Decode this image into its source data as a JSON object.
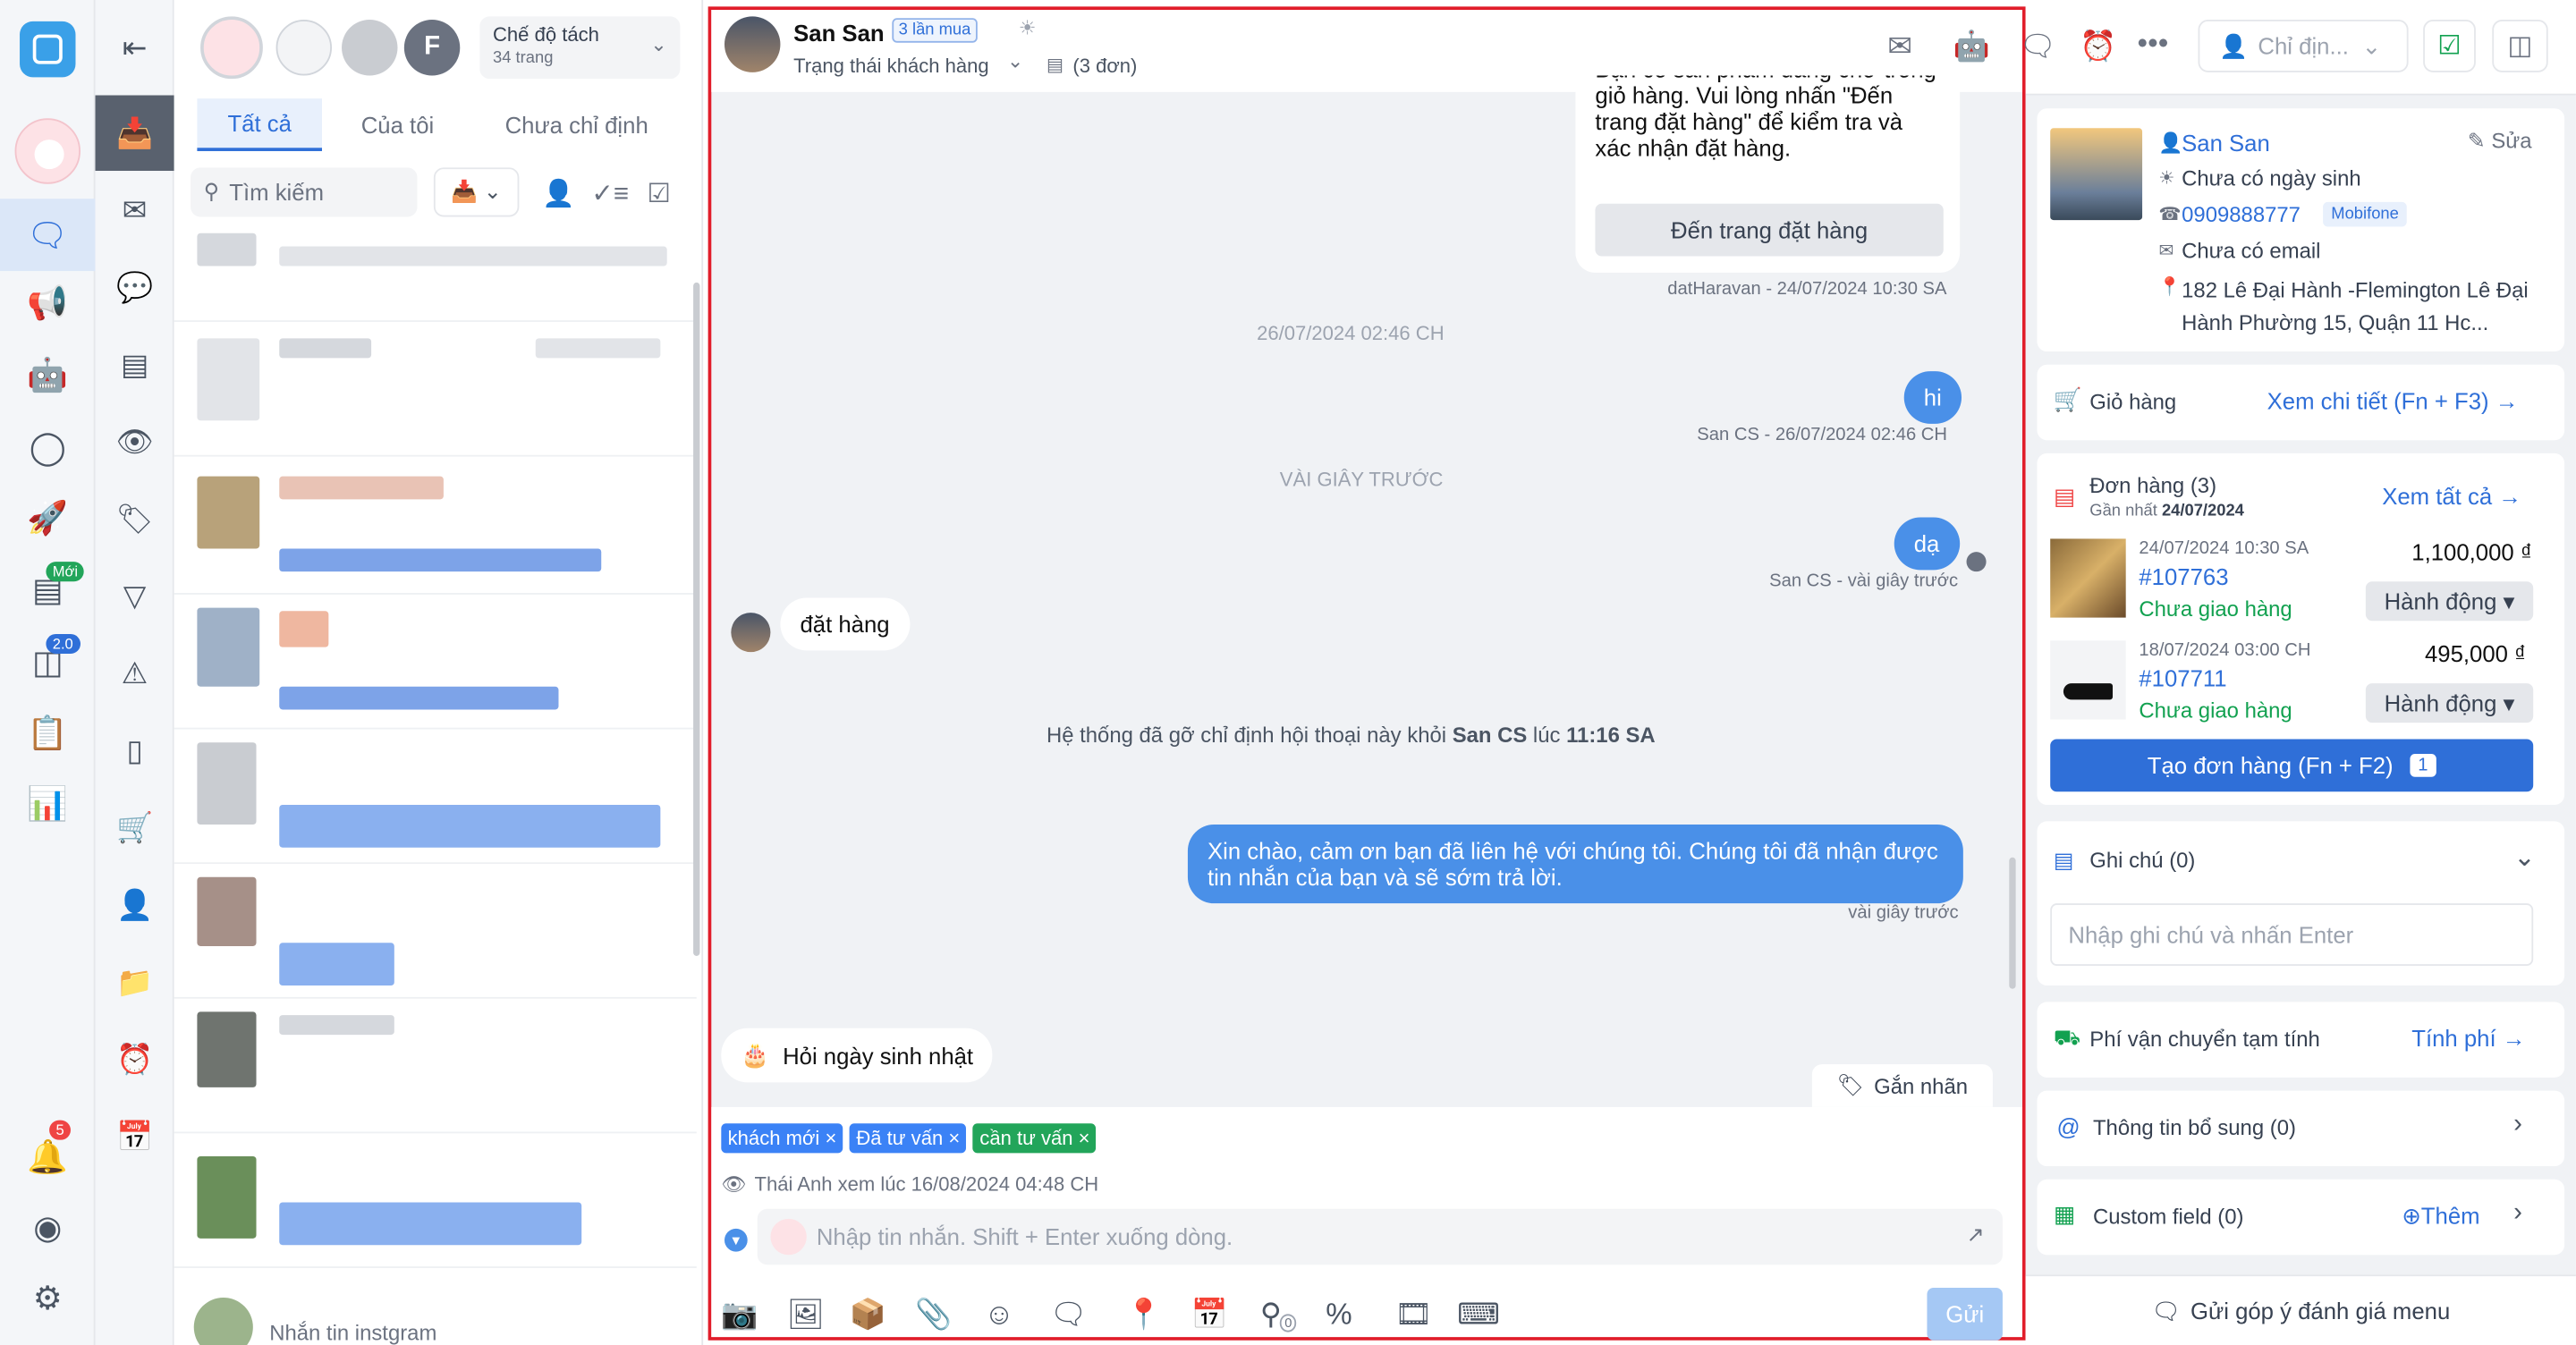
{
  "left_rail": {
    "badge_new": "Mới",
    "badge_version": "2.0",
    "badge_notifications": "5"
  },
  "list_panel": {
    "page_select": {
      "title": "Chế độ tách",
      "subtitle": "34 trang"
    },
    "tabs": [
      {
        "label": "Tất cả"
      },
      {
        "label": "Của tôi"
      },
      {
        "label": "Chưa chỉ định"
      }
    ],
    "search_placeholder": "Tìm kiếm",
    "last_item_text": "Nhắn tin instgram",
    "page_avatar_text": "F"
  },
  "chat": {
    "header": {
      "name": "San San",
      "purchase_badge": "3 lần mua",
      "customer_status": "Trạng thái khách hàng",
      "order_count": "(3 đơn)",
      "assign_placeholder": "Chỉ địn..."
    },
    "messages": {
      "top_bubble_text": "Bạn có sản phẩm đang chờ trong giỏ hàng. Vui lòng nhấn \"Đến trang đặt hàng\" để kiểm tra và xác nhận đặt hàng.",
      "top_bubble_button": "Đến trang đặt hàng",
      "top_bubble_meta": "datHaravan - 24/07/2024 10:30 SA",
      "divider_1": "26/07/2024 02:46 CH",
      "out_1": "hi",
      "out_1_meta": "San CS - 26/07/2024 02:46 CH",
      "divider_2": "VÀI GIÂY TRƯỚC",
      "out_2": "dạ",
      "out_2_meta": "San CS - vài giây trước",
      "in_1": "đặt hàng",
      "system_prefix": "Hệ thống đã gỡ chỉ định hội thoại này khỏi ",
      "system_name": "San CS",
      "system_mid": " lúc ",
      "system_time": "11:16 SA",
      "out_3": "Xin chào, cảm ơn bạn đã liên hệ với chúng tôi. Chúng tôi đã nhận được tin nhắn của bạn và sẽ sớm trả lời.",
      "out_3_meta": "vài giây trước",
      "suggestion": "Hỏi ngày sinh nhật",
      "label_button": "Gắn nhãn"
    },
    "tags": [
      {
        "label": "khách mới",
        "color": "#3b82f6"
      },
      {
        "label": "Đã tư vấn",
        "color": "#3b82f6"
      },
      {
        "label": "cần tư vấn",
        "color": "#22a55a"
      }
    ],
    "seen_text": "Thái Anh xem lúc 16/08/2024 04:48 CH",
    "composer": {
      "placeholder": "Nhập tin nhắn. Shift + Enter xuống dòng.",
      "send": "Gửi",
      "counter": "0"
    }
  },
  "customer": {
    "name": "San San",
    "edit": "Sửa",
    "birthday": "Chưa có ngày sinh",
    "phone": "0909888777",
    "carrier": "Mobifone",
    "email": "Chưa có email",
    "address": "182 Lê Đại Hành -Flemington Lê Đại Hành Phường 15, Quận 11 Hc..."
  },
  "cart": {
    "title": "Giỏ hàng",
    "link": "Xem chi tiết (Fn + F3)"
  },
  "orders": {
    "title": "Đơn hàng (3)",
    "latest_prefix": "Gần nhất ",
    "latest_date": "24/07/2024",
    "view_all": "Xem tất cả",
    "items": [
      {
        "date": "24/07/2024 10:30 SA",
        "code": "#107763",
        "status": "Chưa giao hàng",
        "amount": "1,100,000 ₫",
        "action": "Hành động"
      },
      {
        "date": "18/07/2024 03:00 CH",
        "code": "#107711",
        "status": "Chưa giao hàng",
        "amount": "495,000 ₫",
        "action": "Hành động"
      }
    ],
    "create_button": "Tạo đơn hàng (Fn + F2)",
    "create_badge": "1"
  },
  "notes": {
    "title": "Ghi chú (0)",
    "placeholder": "Nhập ghi chú và nhấn Enter"
  },
  "shipping": {
    "title": "Phí vận chuyển tạm tính",
    "link": "Tính phí"
  },
  "extra_info": {
    "title": "Thông tin bổ sung (0)"
  },
  "custom_field": {
    "title": "Custom field (0)",
    "add": "Thêm"
  },
  "feedback": {
    "label": "Gửi góp ý đánh giá menu"
  },
  "colors": {
    "primary": "#2f6fd8",
    "accent_red": "#e11d2a",
    "bubble_out": "#4a90e8",
    "status_green": "#12a150"
  }
}
